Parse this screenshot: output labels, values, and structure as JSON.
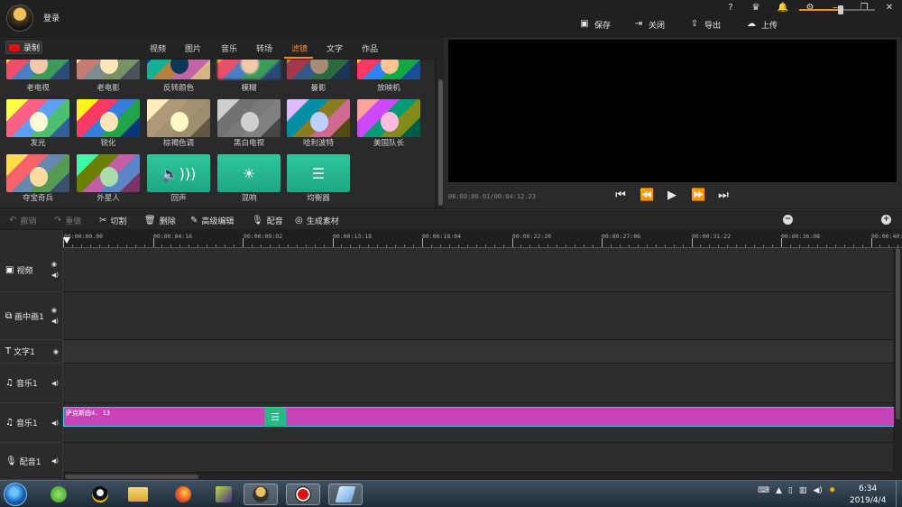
{
  "titlebar": {
    "login_label": "登录",
    "help": "?",
    "actions": [
      {
        "name": "save",
        "label": "保存",
        "icon": "save-icon"
      },
      {
        "name": "close",
        "label": "关闭",
        "icon": "exit-icon"
      },
      {
        "name": "export",
        "label": "导出",
        "icon": "export-icon"
      },
      {
        "name": "upload",
        "label": "上传",
        "icon": "cloud-upload-icon"
      }
    ]
  },
  "media": {
    "record_label": "录制",
    "tabs": [
      {
        "label": "视频"
      },
      {
        "label": "图片"
      },
      {
        "label": "音乐"
      },
      {
        "label": "转场"
      },
      {
        "label": "滤镜",
        "active": true
      },
      {
        "label": "文字"
      },
      {
        "label": "作品"
      }
    ],
    "tiles": [
      {
        "label": "老电视"
      },
      {
        "label": "老电影"
      },
      {
        "label": "反转颜色"
      },
      {
        "label": "模糊"
      },
      {
        "label": "曼影"
      },
      {
        "label": "放映机"
      },
      {
        "label": "发光"
      },
      {
        "label": "锐化"
      },
      {
        "label": "棕褐色调"
      },
      {
        "label": "黑白电视"
      },
      {
        "label": "哈利波特"
      },
      {
        "label": "美国队长"
      },
      {
        "label": "夺宝奇兵"
      },
      {
        "label": "外星人"
      },
      {
        "label": "回声"
      },
      {
        "label": "混响"
      },
      {
        "label": "均衡器"
      }
    ]
  },
  "preview": {
    "time_readout": "00:00:00.01/00:04:12.23"
  },
  "toolbar": {
    "undo": "撤销",
    "redo": "重做",
    "cut": "切割",
    "delete": "删除",
    "advanced_edit": "高级编辑",
    "dub": "配音",
    "generate": "生成素材"
  },
  "timeline": {
    "ticks": [
      "00:00:00.00",
      "00:00:04:16",
      "00:00:09:02",
      "00:00:13:18",
      "00:00:18:04",
      "00:00:22:20",
      "00:00:27:06",
      "00:00:31:22",
      "00:00:36:08",
      "00:00:40:"
    ],
    "tracks": [
      {
        "label": "视频",
        "icon": "play-box-icon"
      },
      {
        "label": "画中画1",
        "icon": "pip-icon"
      },
      {
        "label": "文字1",
        "icon": "text-icon"
      },
      {
        "label": "音乐1",
        "icon": "music-note-icon"
      },
      {
        "label": "音乐1",
        "icon": "music-note-icon"
      },
      {
        "label": "配音1",
        "icon": "mic-icon"
      }
    ],
    "music_clip_label": "萨克斯曲4. 13"
  },
  "taskbar": {
    "time": "6:34",
    "date": "2019/4/4"
  }
}
